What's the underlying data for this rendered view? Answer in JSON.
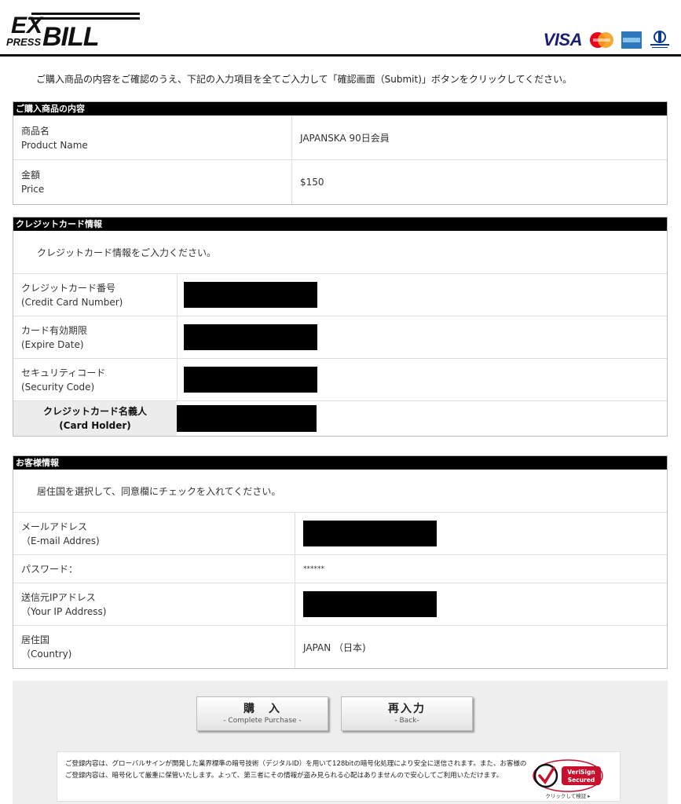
{
  "brand": {
    "logo_text_top": "EX",
    "logo_text_press": "PRESS",
    "logo_text_bill": "BILL"
  },
  "cards": {
    "visa": "VISA",
    "icons": [
      "mastercard-icon",
      "amex-icon",
      "diners-club-icon"
    ]
  },
  "intro": "ご購入商品の内容をご確認のうえ、下記の入力項目を全てご入力して「確認画面（Submit)」ボタンをクリックしてください。",
  "product": {
    "header": "ご購入商品の内容",
    "name_label_ja": "商品名",
    "name_label_en": "Product Name",
    "name_value": "JAPANSKA 90日会員",
    "price_label_ja": "金額",
    "price_label_en": "Price",
    "price_value": "$150"
  },
  "credit": {
    "header": "クレジットカード情報",
    "note": "クレジットカード情報をご入力ください。",
    "number_label_ja": "クレジットカード番号",
    "number_label_en": "(Credit Card Number)",
    "expire_label_ja": "カード有効期限",
    "expire_label_en": "(Expire Date)",
    "security_label_ja": "セキュリティコード",
    "security_label_en": "(Security Code)",
    "holder_label_ja": "クレジットカード名義人",
    "holder_label_en": "(Card Holder)"
  },
  "customer": {
    "header": "お客様情報",
    "note": "居住国を選択して、同意欄にチェックを入れてください。",
    "email_label_ja": "メールアドレス",
    "email_label_en": "（E-mail Addres)",
    "password_label": "パスワード：",
    "password_value": "******",
    "ip_label_ja": "送信元IPアドレス",
    "ip_label_en": "（Your IP Address)",
    "country_label_ja": "居住国",
    "country_label_en": "（Country)",
    "country_value": "JAPAN （日本)"
  },
  "buttons": {
    "purchase_main": "購　入",
    "purchase_sub": "- Complete Purchase -",
    "back_main": "再入力",
    "back_sub": "- Back-"
  },
  "footer": {
    "info": "ご登録内容は、グローバルサインが開発した業界標準の暗号技術（デジタルID）を用いて128bitの暗号化処理により安全に送信されます。また、お客様のご登録内容は、暗号化して厳重に保管いたします。よって、第三者にその情報が盗み見られる心配はありませんので安心してご利用いただけます。",
    "seal_line1": "VeriSign",
    "seal_line2": "Secured",
    "seal_caption": "クリックして検証 ▸"
  }
}
